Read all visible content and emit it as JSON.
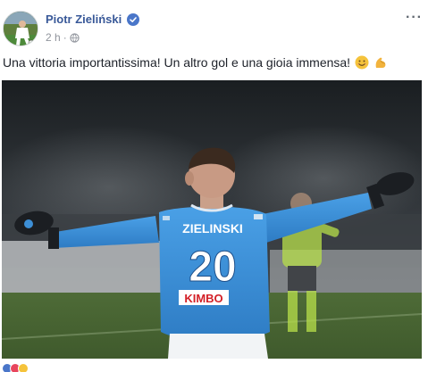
{
  "post": {
    "author": "Piotr Zieliński",
    "time": "2 h",
    "text": "Una vittoria importantissima! Un altro gol e una gioia immensa!",
    "verified": true,
    "privacy_icon": "globe-icon",
    "emojis": [
      "smiling-face-icon",
      "flexed-biceps-icon"
    ]
  },
  "photo": {
    "jersey_name": "ZIELINSKI",
    "jersey_number": "20",
    "sponsor": "KIMBO"
  },
  "colors": {
    "link": "#385898",
    "meta": "#90949c",
    "jersey": "#3d8fd6",
    "verified": "#4a76c9"
  }
}
